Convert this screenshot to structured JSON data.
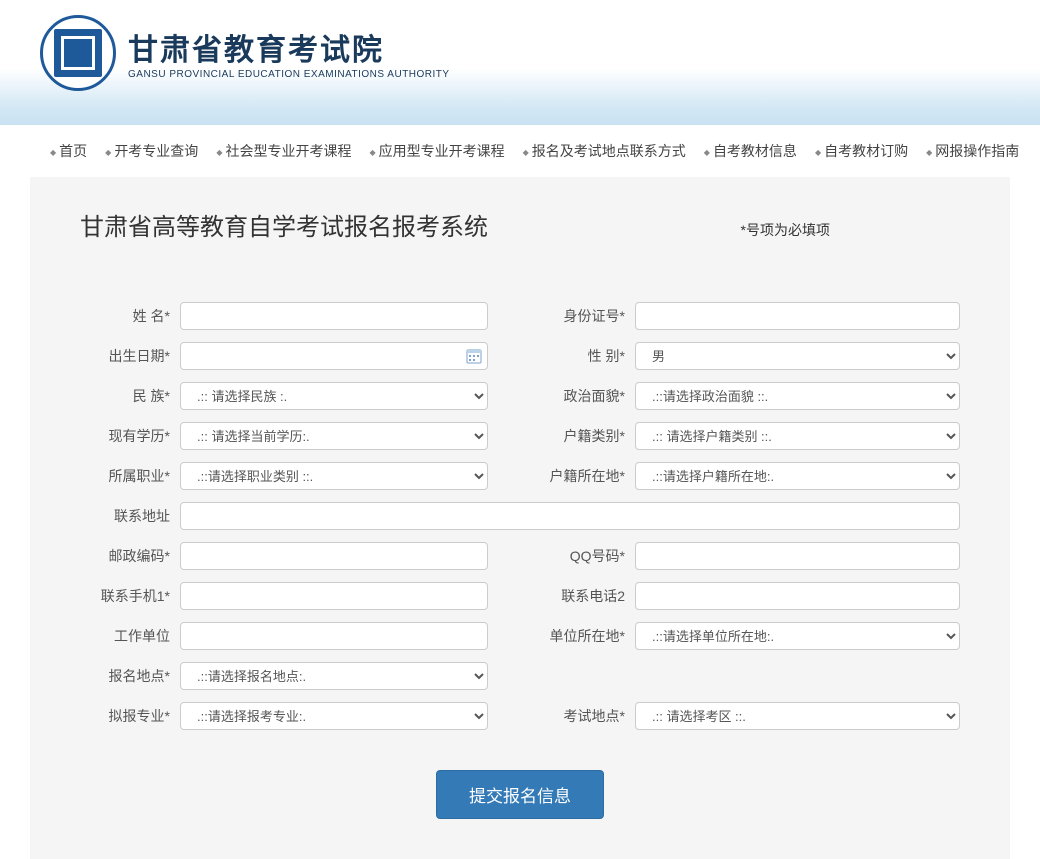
{
  "header": {
    "title_cn": "甘肃省教育考试院",
    "title_en": "GANSU PROVINCIAL EDUCATION EXAMINATIONS AUTHORITY"
  },
  "nav": {
    "items": [
      "首页",
      "开考专业查询",
      "社会型专业开考课程",
      "应用型专业开考课程",
      "报名及考试地点联系方式",
      "自考教材信息",
      "自考教材订购",
      "网报操作指南"
    ]
  },
  "form": {
    "title": "甘肃省高等教育自学考试报名报考系统",
    "required_note": "*号项为必填项",
    "labels": {
      "name": "姓 名*",
      "id_number": "身份证号*",
      "birth_date": "出生日期*",
      "gender": "性 别*",
      "ethnicity": "民 族*",
      "political": "政治面貌*",
      "education": "现有学历*",
      "household_type": "户籍类别*",
      "occupation": "所属职业*",
      "household_location": "户籍所在地*",
      "address": "联系地址",
      "postal_code": "邮政编码*",
      "qq": "QQ号码*",
      "phone1": "联系手机1*",
      "phone2": "联系电话2",
      "work_unit": "工作单位",
      "unit_location": "单位所在地*",
      "reg_location": "报名地点*",
      "major": "拟报专业*",
      "exam_location": "考试地点*"
    },
    "options": {
      "gender": "男",
      "ethnicity": ".:: 请选择民族 :.",
      "political": ".::请选择政治面貌 ::.",
      "education": ".:: 请选择当前学历:.",
      "household_type": ".:: 请选择户籍类别 ::.",
      "occupation": ".::请选择职业类别 ::.",
      "household_location": ".::请选择户籍所在地:.",
      "unit_location": ".::请选择单位所在地:.",
      "reg_location": ".::请选择报名地点:.",
      "major": ".::请选择报考专业:.",
      "exam_location": ".:: 请选择考区 ::."
    },
    "submit_label": "提交报名信息"
  }
}
